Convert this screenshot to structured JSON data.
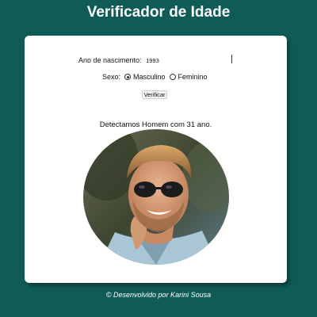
{
  "header": {
    "title": "Verificador de Idade"
  },
  "form": {
    "year_label": "Ano de nascimento:",
    "year_value": "1993",
    "sex_label": "Sexo:",
    "sex_options": [
      "Masculino",
      "Feminino"
    ],
    "sex_selected": "Masculino",
    "verify_label": "Verificar"
  },
  "result": {
    "text": "Detectamos Homem com 31 ano."
  },
  "photo": {
    "icon": "man-with-sunglasses-photo"
  },
  "footer": {
    "text": "© Desenvolvido por Karini Sousa"
  },
  "colors": {
    "background": "#0f5c57",
    "card": "#ffffff",
    "text": "#111111",
    "footer_text": "#ffffff"
  }
}
